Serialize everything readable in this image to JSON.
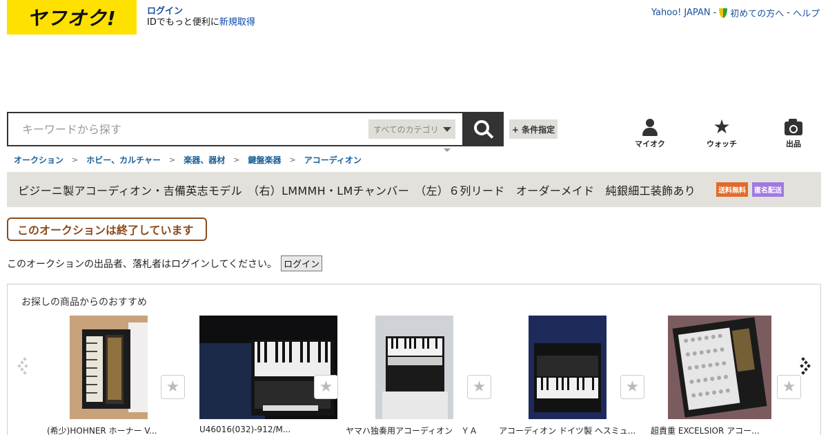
{
  "header": {
    "logo_text": "ヤフオク!",
    "login_label": "ログイン",
    "login_line2_prefix": "IDでもっと便利に",
    "register_label": "新規取得",
    "top_links": [
      "Yahoo! JAPAN",
      "初めての方へ",
      "ヘルプ"
    ],
    "separator": "-"
  },
  "search": {
    "placeholder": "キーワードから探す",
    "category_label": "すべてのカテゴリ",
    "conditions_label": "+ 条件指定"
  },
  "nav": [
    {
      "label": "マイオク",
      "icon": "person-icon"
    },
    {
      "label": "ウォッチ",
      "icon": "star-icon"
    },
    {
      "label": "出品",
      "icon": "camera-icon"
    }
  ],
  "breadcrumb": [
    "オークション",
    "ホビー、カルチャー",
    "楽器、器材",
    "鍵盤楽器",
    "アコーディオン"
  ],
  "breadcrumb_sep": ">",
  "item": {
    "title": "ピジーニ製アコーディオン・吉備英志モデル　（右）LMMMH・LMチャンバー　（左）６列リード　オーダーメイド　純銀細工装飾あり",
    "badge_free_shipping": "送料無料",
    "badge_anonymous": "匿名配送",
    "ended_message": "このオークションは終了しています",
    "login_note": "このオークションの出品者、落札者はログインしてください。",
    "login_button": "ログイン"
  },
  "recommend": {
    "heading": "お探しの商品からのおすすめ",
    "items": [
      {
        "title": "(希少)HOHNER ホーナー V..."
      },
      {
        "title": "U46016(032)-912/M..."
      },
      {
        "title": "ヤマハ独奏用アコーディオン　ＹＡ"
      },
      {
        "title": "アコーディオン ドイツ製 ヘスミュ..."
      },
      {
        "title": "超貴重 EXCELSIOR アコー..."
      }
    ]
  },
  "colors": {
    "logo_bg": "#ffe100",
    "link": "#1a4f9c",
    "ended": "#8b4a1c",
    "badge_free": "#e06b2c",
    "badge_anon": "#a279e0"
  }
}
